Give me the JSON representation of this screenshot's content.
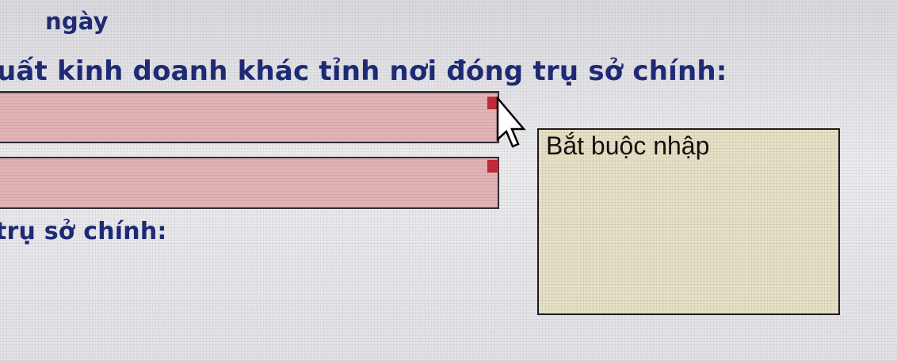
{
  "form": {
    "label_day": "ngày",
    "label_other_province": "uất kinh doanh khác tỉnh nơi đóng trụ sở chính:",
    "label_main_office": "trụ sở chính:",
    "field_1_value": "",
    "field_2_value": ""
  },
  "tooltip": {
    "text": "Bắt buộc nhập"
  },
  "colors": {
    "label_text": "#1f2a74",
    "required_field_bg": "#e0b3b6",
    "required_marker": "#c1283a",
    "tooltip_bg": "#e6e1c6"
  },
  "icons": {
    "cursor": "mouse-pointer-arrow-icon",
    "required_marker": "required-marker-icon"
  }
}
